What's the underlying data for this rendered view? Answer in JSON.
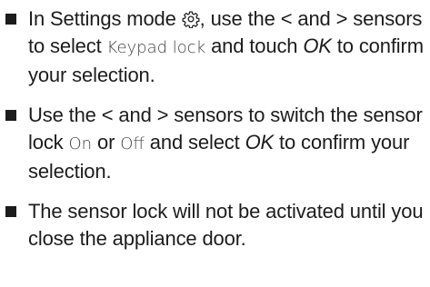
{
  "items": [
    {
      "a": "In Settings mode ",
      "gear_icon": "gear-icon",
      "b": ", use the ",
      "lt": "<",
      "c": " and ",
      "gt": ">",
      "d": " sensors to select ",
      "display": "Keypad lock",
      "e": " and touch ",
      "ok": "OK",
      "f": " to confirm your selection."
    },
    {
      "a": "Use the ",
      "lt": "<",
      "b": " and ",
      "gt": ">",
      "c": " sensors to switch the sensor lock ",
      "on": "On",
      "d": " or ",
      "off": "Off",
      "e": " and select ",
      "ok": "OK",
      "f": " to confirm your selection."
    },
    {
      "text": "The sensor lock will not be activated until you close the appliance door."
    }
  ]
}
